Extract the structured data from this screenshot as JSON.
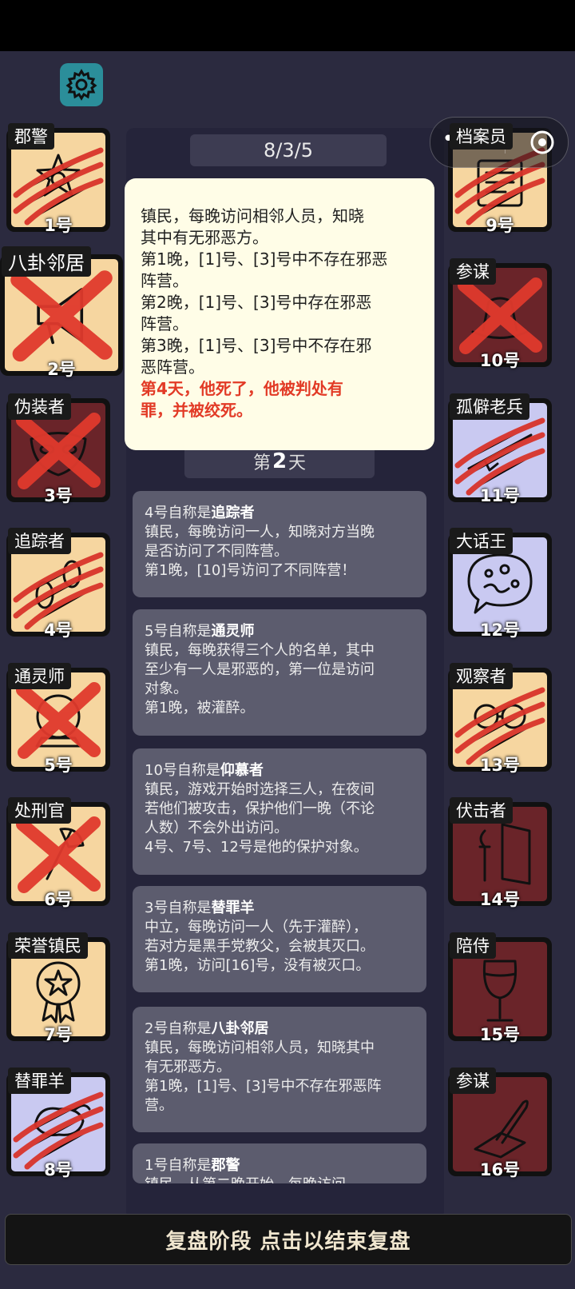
{
  "header": {
    "counter": "8/3/5"
  },
  "players": [
    {
      "role": "郡警",
      "num": "1号",
      "bg": "tan",
      "mark": "claw",
      "icon": "badge-icon"
    },
    {
      "role": "八卦邻居",
      "num": "2号",
      "bg": "tan",
      "mark": "x",
      "icon": "megaphone-icon"
    },
    {
      "role": "伪装者",
      "num": "3号",
      "bg": "maroon",
      "mark": "x",
      "icon": "mask-icon"
    },
    {
      "role": "追踪者",
      "num": "4号",
      "bg": "tan",
      "mark": "claw",
      "icon": "footprints-icon"
    },
    {
      "role": "通灵师",
      "num": "5号",
      "bg": "tan",
      "mark": "x",
      "icon": "crystal-ball-icon"
    },
    {
      "role": "处刑官",
      "num": "6号",
      "bg": "tan",
      "mark": "x",
      "icon": "axe-icon"
    },
    {
      "role": "荣誉镇民",
      "num": "7号",
      "bg": "tan",
      "mark": "none",
      "icon": "medal-icon"
    },
    {
      "role": "替罪羊",
      "num": "8号",
      "bg": "lav",
      "mark": "claw",
      "icon": "goat-icon"
    },
    {
      "role": "档案员",
      "num": "9号",
      "bg": "tan",
      "mark": "claw",
      "icon": "archive-icon"
    },
    {
      "role": "参谋",
      "num": "10号",
      "bg": "maroon",
      "mark": "x",
      "icon": "hat-icon"
    },
    {
      "role": "孤僻老兵",
      "num": "11号",
      "bg": "lav",
      "mark": "claw",
      "icon": "rifle-icon"
    },
    {
      "role": "大话王",
      "num": "12号",
      "bg": "lav",
      "mark": "none",
      "icon": "speech-bubble-icon"
    },
    {
      "role": "观察者",
      "num": "13号",
      "bg": "tan",
      "mark": "claw",
      "icon": "eye-icon"
    },
    {
      "role": "伏击者",
      "num": "14号",
      "bg": "maroon",
      "mark": "none",
      "icon": "door-knife-icon"
    },
    {
      "role": "陪侍",
      "num": "15号",
      "bg": "maroon",
      "mark": "none",
      "icon": "wine-glass-icon"
    },
    {
      "role": "参谋",
      "num": "16号",
      "bg": "maroon",
      "mark": "none",
      "icon": "quill-icon"
    }
  ],
  "popup": {
    "l1": "镇民，每晚访问相邻人员，知晓",
    "l2": "其中有无邪恶方。",
    "l3": "第1晚，[1]号、[3]号中不存在邪恶",
    "l4": "阵营。",
    "l5": "第2晚，[1]号、[3]号中存在邪恶",
    "l6": "阵营。",
    "l7": "第3晚，[1]号、[3]号中不存在邪",
    "l8": "恶阵营。",
    "r1": "第4天，他死了，他被判处有",
    "r2": "罪，并被绞死。"
  },
  "day": {
    "prefix": "第",
    "num": "2",
    "suffix": "天"
  },
  "entries": [
    {
      "head_pre": "4号自称是",
      "head_role": "追踪者",
      "lines": [
        "镇民，每晚访问一人，知晓对方当晚",
        "是否访问了不同阵营。",
        "第1晚，[10]号访问了不同阵营！"
      ]
    },
    {
      "head_pre": "5号自称是",
      "head_role": "通灵师",
      "lines": [
        "镇民，每晚获得三个人的名单，其中",
        "至少有一人是邪恶的，第一位是访问",
        "对象。",
        "第1晚，被灌醉。"
      ]
    },
    {
      "head_pre": "10号自称是",
      "head_role": "仰慕者",
      "lines": [
        "镇民，游戏开始时选择三人，在夜间",
        "若他们被攻击，保护他们一晚（不论",
        "人数）不会外出访问。",
        "4号、7号、12号是他的保护对象。"
      ]
    },
    {
      "head_pre": "3号自称是",
      "head_role": "替罪羊",
      "lines": [
        "中立，每晚访问一人（先于灌醉），",
        "若对方是黑手党教父，会被其灭口。",
        "第1晚，访问[16]号，没有被灭口。"
      ]
    },
    {
      "head_pre": "2号自称是",
      "head_role": "八卦邻居",
      "lines": [
        "镇民，每晚访问相邻人员，知晓其中",
        "有无邪恶方。",
        "第1晚，[1]号、[3]号中不存在邪恶阵",
        "营。"
      ]
    },
    {
      "head_pre": "1号自称是",
      "head_role": "郡警",
      "lines": [
        "镇民，从第二晚开始，每晚访问"
      ]
    }
  ],
  "footer": {
    "label": "复盘阶段 点击以结束复盘"
  },
  "colors": {
    "claw": "#d9342b",
    "popup_red": "#e23a26",
    "gear": "#2b8e9a"
  }
}
